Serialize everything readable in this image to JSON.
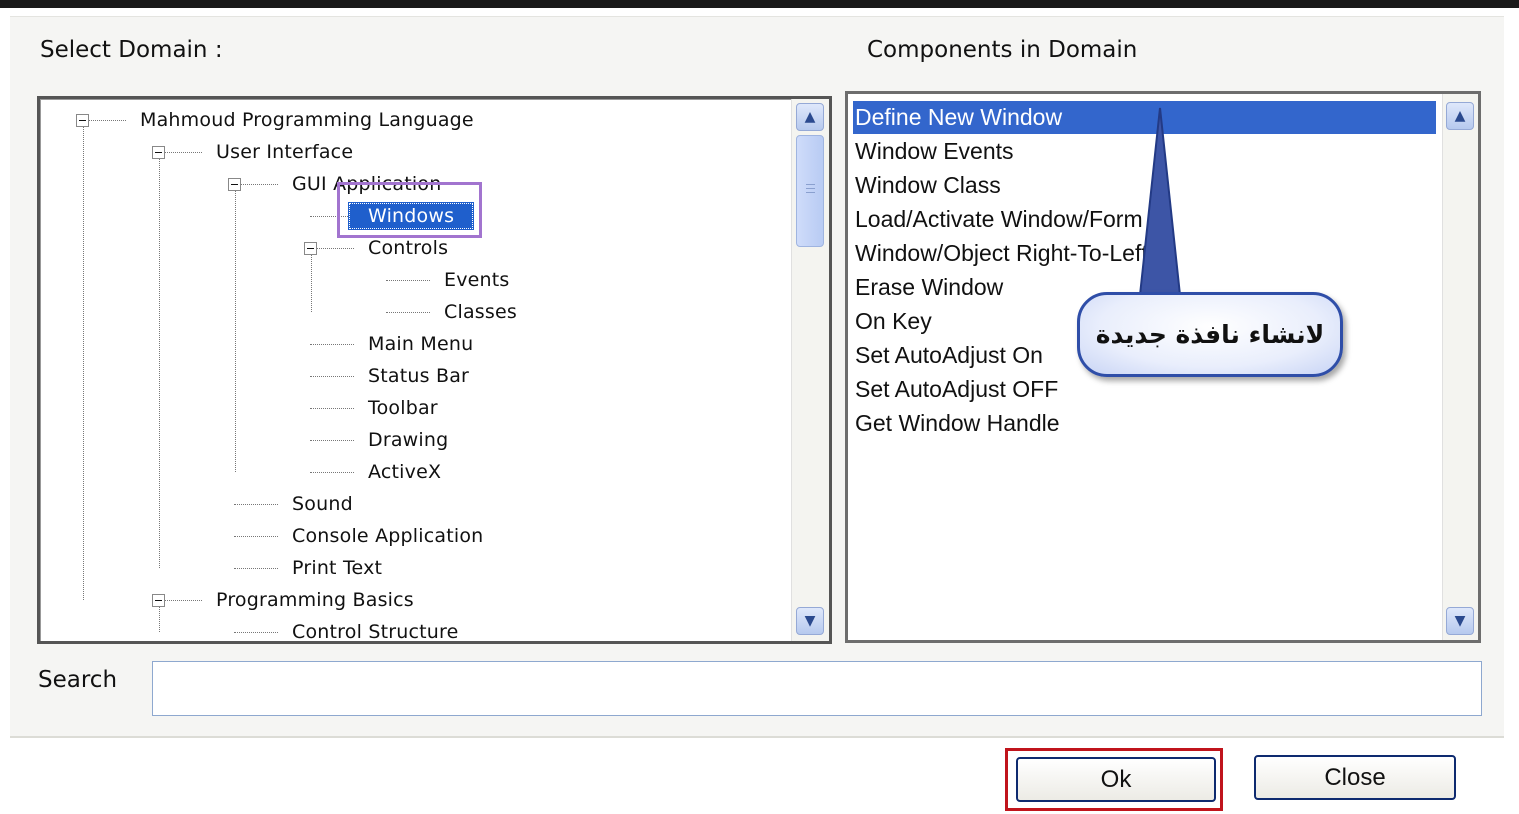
{
  "labels": {
    "select_domain": "Select Domain :",
    "components_in_domain": "Components in Domain",
    "search": "Search"
  },
  "tree": [
    {
      "label": "Mahmoud Programming Language",
      "level": 0
    },
    {
      "label": "User Interface",
      "level": 1
    },
    {
      "label": "GUI Application",
      "level": 2
    },
    {
      "label": "Windows",
      "level": 3,
      "selected": true
    },
    {
      "label": "Controls",
      "level": 3
    },
    {
      "label": "Events",
      "level": 4
    },
    {
      "label": "Classes",
      "level": 4
    },
    {
      "label": "Main Menu",
      "level": 3
    },
    {
      "label": "Status Bar",
      "level": 3
    },
    {
      "label": "Toolbar",
      "level": 3
    },
    {
      "label": "Drawing",
      "level": 3
    },
    {
      "label": "ActiveX",
      "level": 3
    },
    {
      "label": "Sound",
      "level": 2
    },
    {
      "label": "Console Application",
      "level": 2
    },
    {
      "label": "Print Text",
      "level": 2
    },
    {
      "label": "Programming Basics",
      "level": 1
    },
    {
      "label": "Control Structure",
      "level": 2
    }
  ],
  "components": [
    "Define New Window",
    "Window Events",
    "Window Class",
    "Load/Activate Window/Form",
    "Window/Object Right-To-Left",
    "Erase Window",
    "On Key",
    "Set AutoAdjust On",
    "Set AutoAdjust OFF",
    "Get Window Handle"
  ],
  "selected_component": "Define New Window",
  "callout_text": "لانشاء نافذة جديدة",
  "search": {
    "value": ""
  },
  "buttons": {
    "ok": "Ok",
    "close": "Close"
  },
  "colors": {
    "selection": "#3366cc",
    "button_border": "#0e2a6f",
    "ok_highlight": "#c0141c",
    "tree_highlight": "#a274cf",
    "callout_border": "#2f4ea8"
  },
  "icons": {
    "scroll_up": "chevron-up-icon",
    "scroll_down": "chevron-down-icon",
    "tree_collapse": "minus-box-icon"
  }
}
